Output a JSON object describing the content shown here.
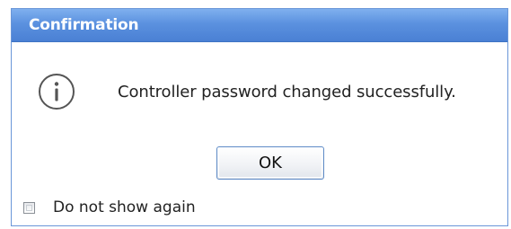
{
  "dialog": {
    "title": "Confirmation",
    "icon": "info-icon",
    "message": "Controller password changed successfully.",
    "ok_label": "OK",
    "checkbox_label": "Do not show again",
    "checkbox_checked": false
  },
  "colors": {
    "titlebar": "#5b91df",
    "title_text": "#ffffff",
    "button_border": "#5f8cc7"
  }
}
